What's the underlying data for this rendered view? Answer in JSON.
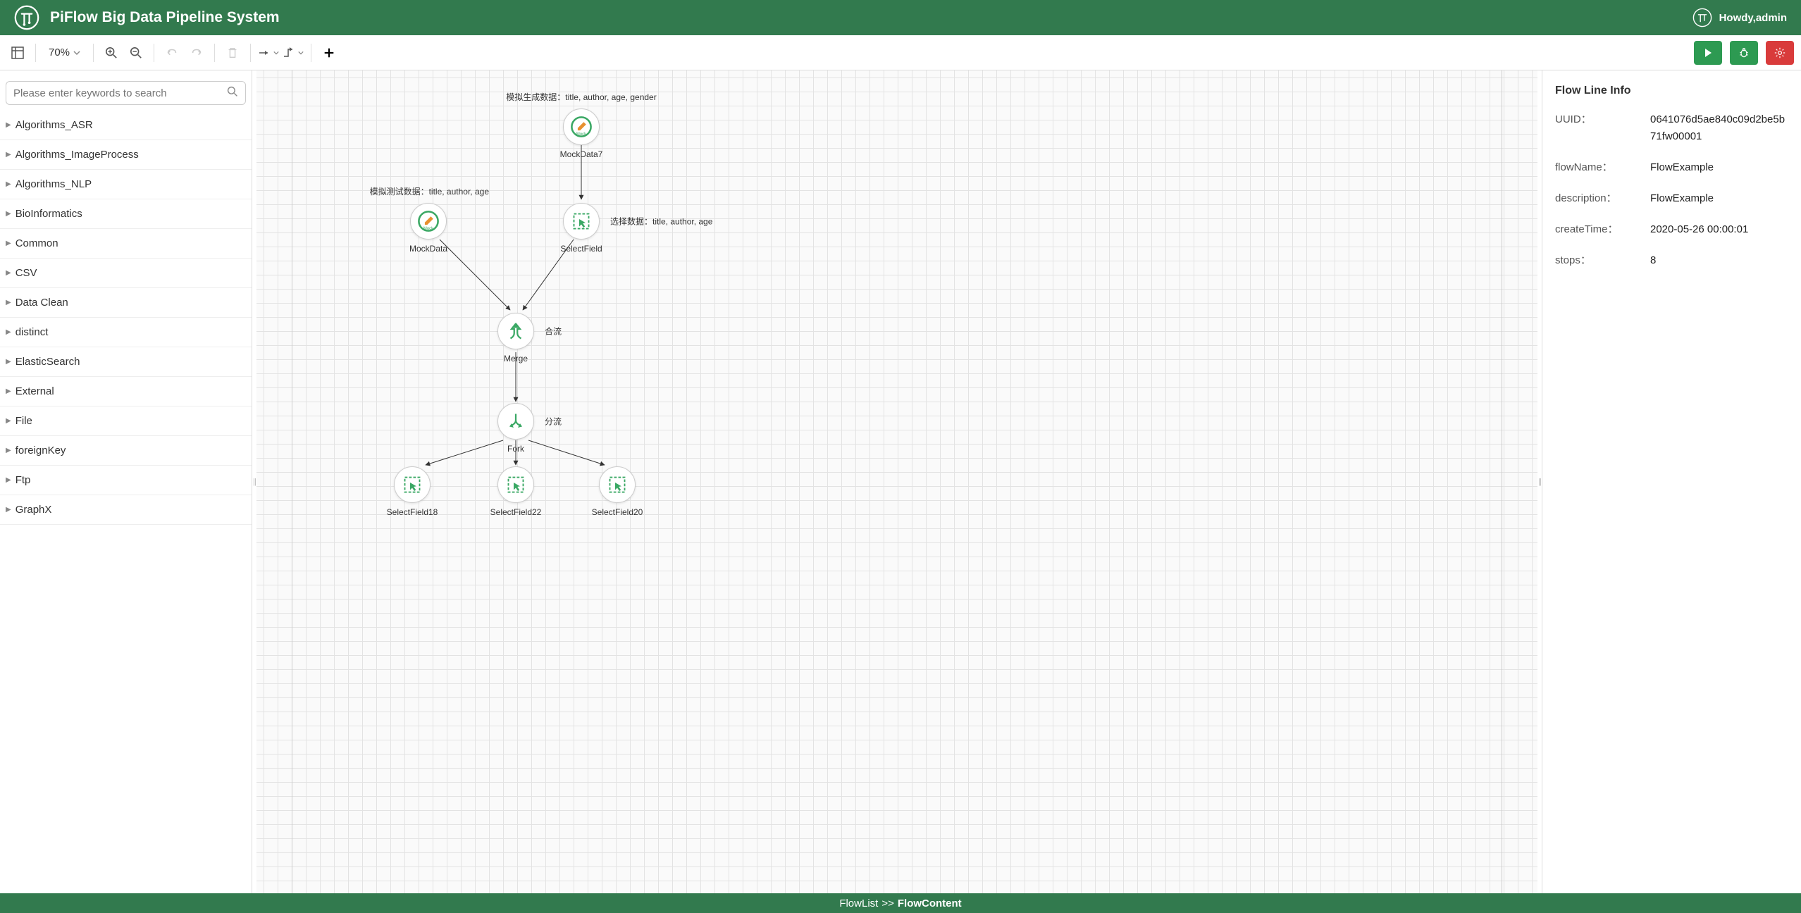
{
  "header": {
    "title": "PiFlow Big Data Pipeline System",
    "user_label": "Howdy,admin"
  },
  "toolbar": {
    "zoom": "70%"
  },
  "search": {
    "placeholder": "Please enter keywords to search"
  },
  "sidebar_items": [
    "Algorithms_ASR",
    "Algorithms_ImageProcess",
    "Algorithms_NLP",
    "BioInformatics",
    "Common",
    "CSV",
    "Data Clean",
    "distinct",
    "ElasticSearch",
    "External",
    "File",
    "foreignKey",
    "Ftp",
    "GraphX"
  ],
  "nodes": {
    "mockdata7": {
      "label": "MockData7",
      "annotation": "模拟生成数据：title, author, age, gender"
    },
    "mockdata": {
      "label": "MockData",
      "annotation": "模拟测试数据：title, author, age"
    },
    "selectfield": {
      "label": "SelectField",
      "annotation": "选择数据：title, author, age"
    },
    "merge": {
      "label": "Merge",
      "annotation": "合流"
    },
    "fork": {
      "label": "Fork",
      "annotation": "分流"
    },
    "selectfield18": {
      "label": "SelectField18"
    },
    "selectfield22": {
      "label": "SelectField22"
    },
    "selectfield20": {
      "label": "SelectField20"
    }
  },
  "info_panel": {
    "title": "Flow Line Info",
    "rows": [
      {
        "key": "UUID：",
        "val": "0641076d5ae840c09d2be5b71fw00001"
      },
      {
        "key": "flowName：",
        "val": "FlowExample"
      },
      {
        "key": "description：",
        "val": "FlowExample"
      },
      {
        "key": "createTime：",
        "val": "2020-05-26 00:00:01"
      },
      {
        "key": "stops：",
        "val": "8"
      }
    ]
  },
  "footer": {
    "link": "FlowList",
    "sep": ">>",
    "current": "FlowContent"
  }
}
